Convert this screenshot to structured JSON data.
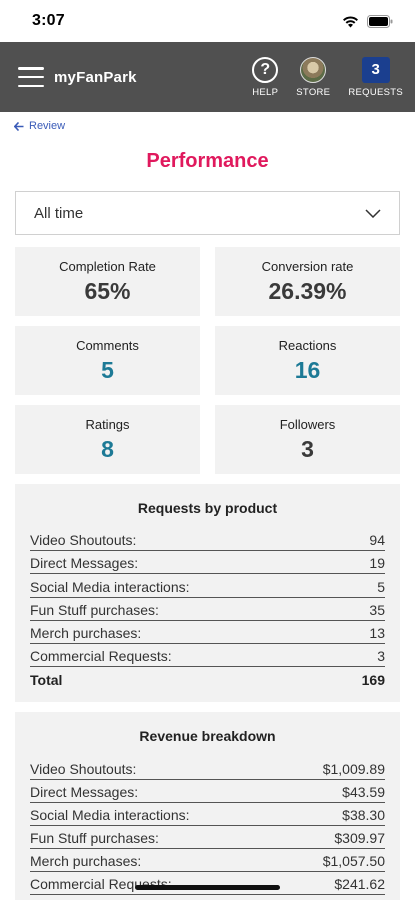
{
  "status": {
    "time": "3:07"
  },
  "appbar": {
    "brand": "myFanPark",
    "help_label": "HELP",
    "store_label": "STORE",
    "requests_label": "REQUESTS",
    "requests_count": "3"
  },
  "back": {
    "label": "Review"
  },
  "page": {
    "title": "Performance"
  },
  "filter": {
    "value": "All time"
  },
  "stats": [
    {
      "label": "Completion Rate",
      "value": "65%"
    },
    {
      "label": "Conversion rate",
      "value": "26.39%"
    },
    {
      "label": "Comments",
      "value": "5"
    },
    {
      "label": "Reactions",
      "value": "16"
    },
    {
      "label": "Ratings",
      "value": "8"
    },
    {
      "label": "Followers",
      "value": "3"
    }
  ],
  "requests_by_product": {
    "title": "Requests by product",
    "rows": [
      {
        "label": "Video Shoutouts:",
        "value": "94"
      },
      {
        "label": "Direct Messages:",
        "value": "19"
      },
      {
        "label": "Social Media interactions:",
        "value": "5"
      },
      {
        "label": "Fun Stuff purchases:",
        "value": "35"
      },
      {
        "label": "Merch purchases:",
        "value": "13"
      },
      {
        "label": "Commercial Requests:",
        "value": "3"
      }
    ],
    "total": {
      "label": "Total",
      "value": "169"
    }
  },
  "revenue_breakdown": {
    "title": "Revenue breakdown",
    "rows": [
      {
        "label": "Video Shoutouts:",
        "value": "$1,009.89"
      },
      {
        "label": "Direct Messages:",
        "value": "$43.59"
      },
      {
        "label": "Social Media interactions:",
        "value": "$38.30"
      },
      {
        "label": "Fun Stuff purchases:",
        "value": "$309.97"
      },
      {
        "label": "Merch purchases:",
        "value": "$1,057.50"
      },
      {
        "label": "Commercial Requests:",
        "value": "$241.62"
      }
    ]
  },
  "colors": {
    "title_pink": "#e0195d",
    "teal_value": "#1d7a96",
    "appbar_bg": "#505050",
    "badge_blue": "#1b3f8f"
  }
}
